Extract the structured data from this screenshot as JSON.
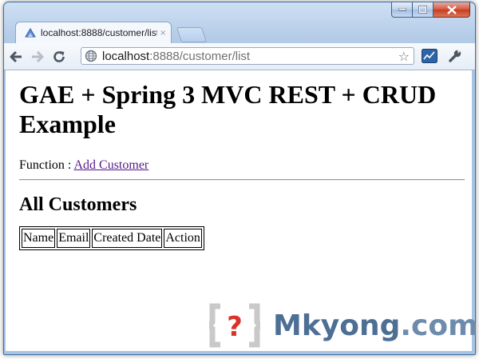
{
  "browser": {
    "tab": {
      "title": "localhost:8888/customer/list",
      "close_glyph": "×"
    },
    "address_bar": {
      "host": "localhost",
      "rest": ":8888/customer/list"
    },
    "icons": [
      "back-arrow-icon",
      "forward-arrow-icon",
      "reload-icon",
      "globe-icon",
      "star-icon",
      "extension-chart-icon",
      "wrench-icon"
    ]
  },
  "page": {
    "heading": "GAE + Spring 3 MVC REST + CRUD Example",
    "function_label": "Function :",
    "add_customer_link": "Add Customer",
    "subheading": "All Customers",
    "table": {
      "columns": [
        "Name",
        "Email",
        "Created Date",
        "Action"
      ]
    }
  },
  "watermark": {
    "brand": "Mkyong",
    "tld": ".com"
  },
  "colors": {
    "visited_link": "#551a8b",
    "watermark_blue": "#4d6f94",
    "watermark_icon": "#c9c9c9",
    "watermark_question": "#d9322a"
  }
}
